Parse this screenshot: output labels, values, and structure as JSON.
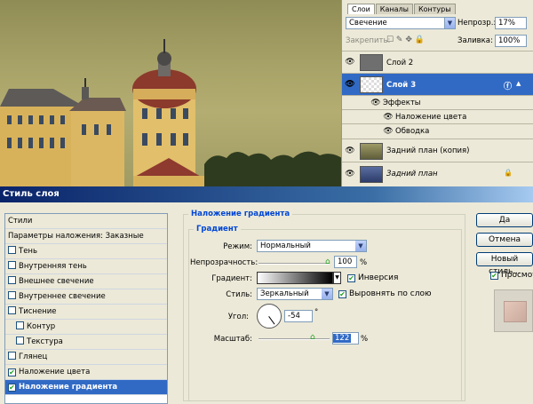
{
  "layers_panel": {
    "tabs": [
      "Слои",
      "Каналы",
      "Контуры"
    ],
    "blend_mode": "Свечение",
    "opacity_label": "Непрозр.:",
    "opacity_value": "17%",
    "lock_label": "Закрепить:",
    "fill_label": "Заливка:",
    "fill_value": "100%",
    "layers": [
      {
        "name": "Слой 2"
      },
      {
        "name": "Слой 3"
      },
      {
        "name": "Эффекты"
      },
      {
        "name": "Наложение цвета"
      },
      {
        "name": "Обводка"
      },
      {
        "name": "Задний план (копия)"
      },
      {
        "name": "Задний план"
      }
    ]
  },
  "dialog": {
    "title": "Стиль слоя",
    "styles_header": "Стили",
    "blend_options": "Параметры наложения: Заказные",
    "styles": [
      {
        "label": "Тень",
        "checked": false
      },
      {
        "label": "Внутренняя тень",
        "checked": false
      },
      {
        "label": "Внешнее свечение",
        "checked": false
      },
      {
        "label": "Внутреннее свечение",
        "checked": false
      },
      {
        "label": "Тиснение",
        "checked": false
      },
      {
        "label": "Контур",
        "checked": false
      },
      {
        "label": "Текстура",
        "checked": false
      },
      {
        "label": "Глянец",
        "checked": false
      },
      {
        "label": "Наложение цвета",
        "checked": true
      },
      {
        "label": "Наложение градиента",
        "checked": true
      }
    ],
    "section_title": "Наложение градиента",
    "group_title": "Градиент",
    "mode_label": "Режим:",
    "mode_value": "Нормальный",
    "opacity_label": "Непрозрачность:",
    "opacity_value": "100",
    "percent": "%",
    "gradient_label": "Градиент:",
    "reverse_label": "Инверсия",
    "style_label": "Стиль:",
    "style_value": "Зеркальный",
    "align_label": "Выровнять по слою",
    "angle_label": "Угол:",
    "angle_value": "-54",
    "degree": "°",
    "scale_label": "Масштаб:",
    "scale_value": "122",
    "buttons": {
      "ok": "Да",
      "cancel": "Отмена",
      "new_style": "Новый стиль...",
      "preview": "Просмотр"
    }
  }
}
